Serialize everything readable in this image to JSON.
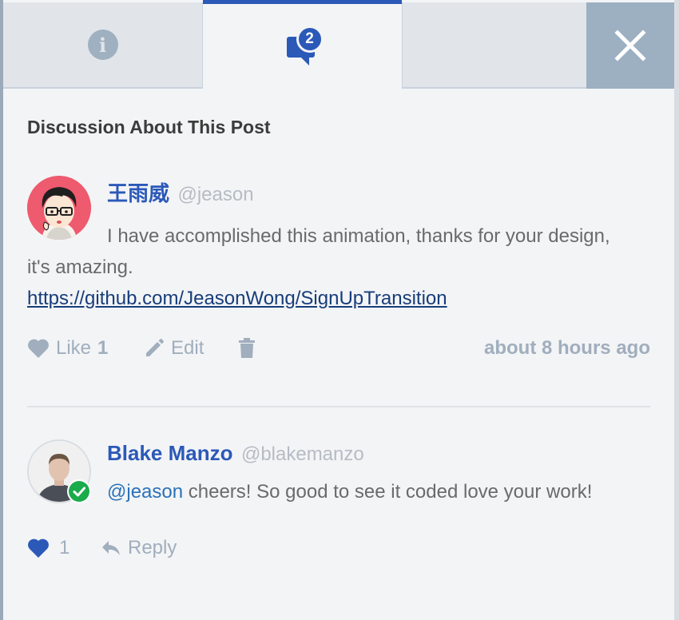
{
  "tabs": [
    {
      "name": "info",
      "icon": "info-icon",
      "active": false
    },
    {
      "name": "discussion",
      "icon": "chat-bubble-icon",
      "badge": "2",
      "active": true
    },
    {
      "name": "blank",
      "active": false
    },
    {
      "name": "close",
      "icon": "close-icon",
      "active": false
    }
  ],
  "section": {
    "title": "Discussion About This Post"
  },
  "comments": [
    {
      "author": "王雨威",
      "handle": "@jeason",
      "text": "I have accomplished this animation, thanks for your design, it's amazing.",
      "link": "https://github.com/JeasonWong/SignUpTransition",
      "like_label": "Like",
      "like_count": "1",
      "edit_label": "Edit",
      "timestamp": "about 8 hours ago"
    },
    {
      "author": "Blake Manzo",
      "handle": "@blakemanzo",
      "mention": "@jeason",
      "text": " cheers! So good to see it coded love your work!",
      "like_count": "1",
      "reply_label": "Reply",
      "verified": true
    }
  ],
  "colors": {
    "accent": "#2b59b8",
    "muted": "#a0aebd",
    "verified": "#1aab4b",
    "avatar_bg": "#ee5a6e"
  }
}
